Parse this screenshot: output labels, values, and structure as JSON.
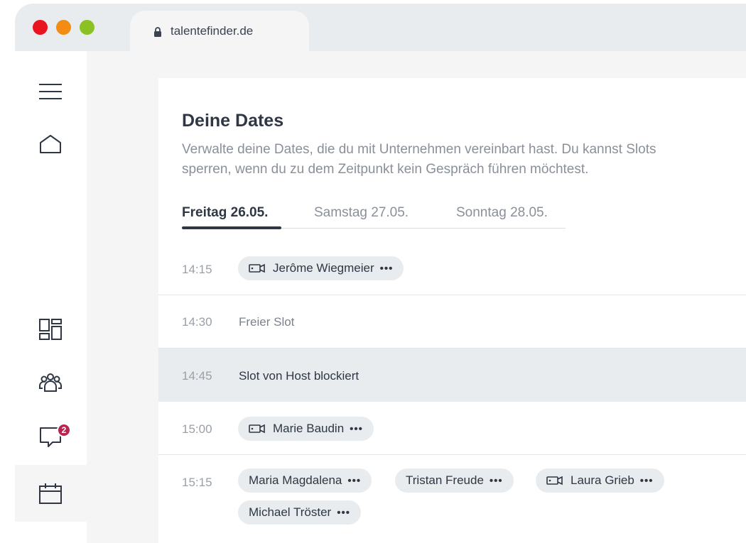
{
  "browser": {
    "url": "talentefinder.de",
    "icons": [
      "lock-icon"
    ]
  },
  "sidebar": {
    "icons": [
      "menu-icon",
      "home-icon",
      "dashboard-icon",
      "people-icon",
      "chat-icon",
      "calendar-icon"
    ],
    "chat_badge": "2"
  },
  "page": {
    "title": "Deine Dates",
    "description_line1": "Verwalte deine Dates, die du mit Unternehmen vereinbart hast. Du kannst Slots",
    "description_line2": "sperren, wenn du zu dem Zeitpunkt kein Gespräch führen möchtest."
  },
  "day_tabs": [
    {
      "label": "Freitag 26.05.",
      "active": true
    },
    {
      "label": "Samstag 27.05.",
      "active": false
    },
    {
      "label": "Sonntag 28.05.",
      "active": false
    }
  ],
  "slots": [
    {
      "time": "14:15",
      "chips": [
        {
          "name": "Jerôme Wiegmeier",
          "icon": "video-icon",
          "more": "•••"
        }
      ]
    },
    {
      "time": "14:30",
      "text": "Freier Slot"
    },
    {
      "time": "14:45",
      "text": "Slot von Host blockiert",
      "blocked": true
    },
    {
      "time": "15:00",
      "chips": [
        {
          "name": "Marie Baudin",
          "icon": "video-icon",
          "more": "•••"
        }
      ]
    },
    {
      "time": "15:15",
      "chips": [
        {
          "name": "Maria Magdalena",
          "more": "•••"
        },
        {
          "name": "Tristan Freude",
          "more": "•••"
        },
        {
          "name": "Laura Grieb",
          "icon": "video-icon",
          "more": "•••"
        },
        {
          "name": "Michael Tröster",
          "more": "•••"
        }
      ]
    }
  ],
  "colors": {
    "text": "#2f3744",
    "muted": "#8a9099",
    "chip_bg": "#e8ecef",
    "badge": "#b8254e",
    "traffic_red": "#e8141e",
    "traffic_orange": "#f28c13",
    "traffic_green": "#8bc122"
  }
}
